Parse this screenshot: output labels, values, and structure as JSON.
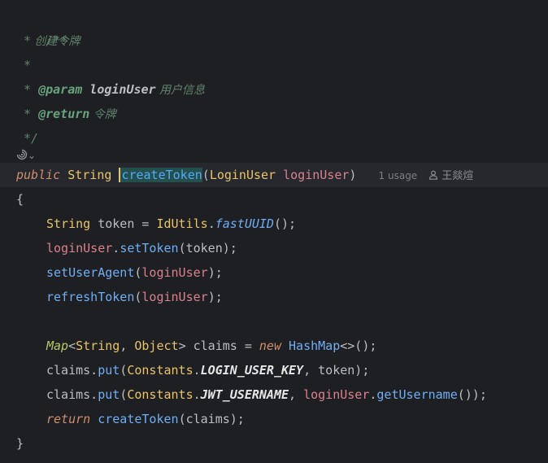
{
  "code": {
    "doc_open": "/**",
    "doc_star": " *",
    "doc_line1": " 创建令牌",
    "param_tag": "@param",
    "param_name": "loginUser",
    "param_desc": " 用户信息",
    "return_tag": "@return",
    "return_desc": " 令牌",
    "doc_close": " */",
    "sig_public": "public",
    "sig_string": "String",
    "sig_method": "createToken",
    "sig_open": "(",
    "sig_ptype": "LoginUser",
    "sig_pname": "loginUser",
    "sig_close": ")",
    "open_brace": "{",
    "close_brace": "}",
    "l1_type": "String",
    "l1_var": " token = ",
    "l1_cls": "IdUtils",
    "l1_dot": ".",
    "l1_call": "fastUUID",
    "l1_end": "();",
    "l2_obj": "loginUser",
    "l2_dot": ".",
    "l2_call": "setToken",
    "l2_args": "(token);",
    "l3_call": "setUserAgent",
    "l3_open": "(",
    "l3_arg": "loginUser",
    "l3_end": ");",
    "l4_call": "refreshToken",
    "l4_open": "(",
    "l4_arg": "loginUser",
    "l4_end": ");",
    "l5_iface": "Map",
    "l5_lt": "<",
    "l5_t1": "String",
    "l5_comma": ", ",
    "l5_t2": "Object",
    "l5_gt": "> claims = ",
    "l5_new": "new",
    "l5_cls": " HashMap",
    "l5_end": "<>();",
    "l6_obj": "claims.",
    "l6_call": "put",
    "l6_open": "(",
    "l6_cls": "Constants",
    "l6_dot": ".",
    "l6_const": "LOGIN_USER_KEY",
    "l6_end": ", token);",
    "l7_obj": "claims.",
    "l7_call": "put",
    "l7_open": "(",
    "l7_cls": "Constants",
    "l7_dot": ".",
    "l7_const": "JWT_USERNAME",
    "l7_comma": ", ",
    "l7_arg": "loginUser",
    "l7_dot2": ".",
    "l7_call2": "getUsername",
    "l7_end": "());",
    "l8_ret": "return",
    "l8_call": " createToken",
    "l8_end": "(claims);"
  },
  "inlay": {
    "usage": "1 usage",
    "author": "王燚煊"
  },
  "gutter": {
    "icon": "ai-assistant-icon",
    "chevron": "⌄"
  },
  "colors": {
    "background": "#1e1f22",
    "current_line": "#26282e",
    "keyword": "#cf8e6d",
    "method": "#56a8f5",
    "doc_comment": "#5f826b"
  }
}
